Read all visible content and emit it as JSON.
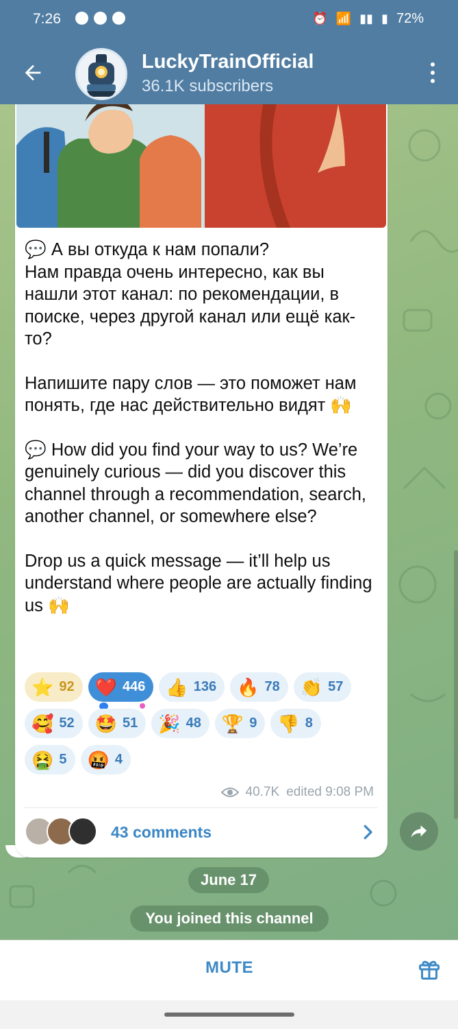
{
  "status_bar": {
    "time": "7:26",
    "battery": "72%"
  },
  "header": {
    "title": "LuckyTrainOfficial",
    "subtitle": "36.1K subscribers"
  },
  "message": {
    "paragraphs": [
      "💬 А вы откуда к нам попали?\nНам правда очень интересно, как вы нашли этот канал: по рекомендации, в поиске, через другой канал или ещё как-то?",
      "Напишите пару слов — это поможет нам понять, где нас действительно видят 🙌",
      "💬 How did you find your way to us? We’re genuinely curious — did you discover this channel through a recommendation, search, another channel, or somewhere else?",
      "Drop us a quick message — it’ll help us understand where people are actually finding us 🙌"
    ],
    "reactions": [
      {
        "emoji": "⭐",
        "count": "92",
        "style": "starred"
      },
      {
        "emoji": "❤️",
        "count": "446",
        "style": "chosen"
      },
      {
        "emoji": "👍",
        "count": "136",
        "style": ""
      },
      {
        "emoji": "🔥",
        "count": "78",
        "style": ""
      },
      {
        "emoji": "👏",
        "count": "57",
        "style": ""
      },
      {
        "emoji": "🥰",
        "count": "52",
        "style": ""
      },
      {
        "emoji": "🤩",
        "count": "51",
        "style": ""
      },
      {
        "emoji": "🎉",
        "count": "48",
        "style": ""
      },
      {
        "emoji": "🏆",
        "count": "9",
        "style": ""
      },
      {
        "emoji": "👎",
        "count": "8",
        "style": ""
      },
      {
        "emoji": "🤮",
        "count": "5",
        "style": ""
      },
      {
        "emoji": "🤬",
        "count": "4",
        "style": ""
      }
    ],
    "views": "40.7K",
    "edited": "edited 9:08 PM",
    "comments": "43 comments"
  },
  "service": {
    "date": "June 17",
    "joined": "You joined this channel"
  },
  "bottom": {
    "mute": "MUTE"
  },
  "colors": {
    "header": "#517da2",
    "accent": "#3e8ac6",
    "chosen_reaction": "#3f8fd8"
  }
}
